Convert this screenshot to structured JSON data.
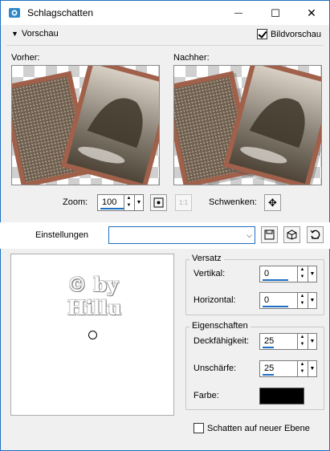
{
  "window": {
    "title": "Schlagschatten",
    "minimize_symbol": "—",
    "maximize_symbol": "☐",
    "close_symbol": "✕"
  },
  "preview_section": {
    "toggle_label": "Vorschau",
    "bildvorschau_label": "Bildvorschau",
    "bildvorschau_checked": true,
    "before_label": "Vorher:",
    "after_label": "Nachher:"
  },
  "zoom": {
    "label": "Zoom:",
    "value": "100",
    "pan_label": "Schwenken:"
  },
  "settings": {
    "label": "Einstellungen",
    "value": ""
  },
  "watermark": {
    "line1": "© by",
    "line2": "Hillu"
  },
  "offset": {
    "title": "Versatz",
    "vertical_label": "Vertikal:",
    "vertical_value": "0",
    "horizontal_label": "Horizontal:",
    "horizontal_value": "0"
  },
  "properties": {
    "title": "Eigenschaften",
    "opacity_label": "Deckfähigkeit:",
    "opacity_value": "25",
    "blur_label": "Unschärfe:",
    "blur_value": "25",
    "color_label": "Farbe:",
    "color_value": "#000000"
  },
  "shadow_new_layer": {
    "label": "Schatten auf neuer Ebene",
    "checked": false
  },
  "colors": {
    "accent": "#1e6fc2",
    "frame_copper": "#a0604a"
  }
}
